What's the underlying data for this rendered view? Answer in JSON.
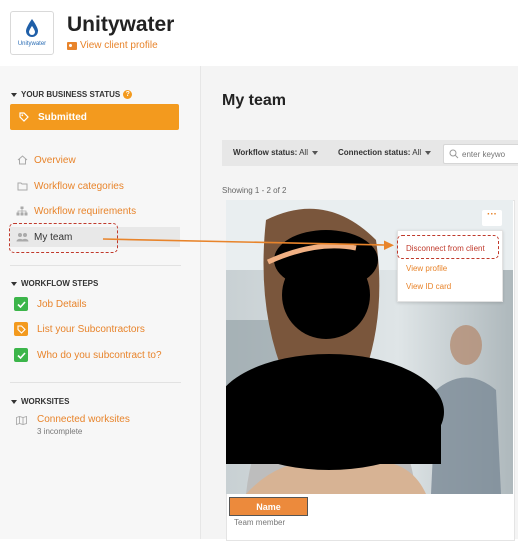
{
  "header": {
    "logo_word": "Unitywater",
    "client_title": "Unitywater",
    "client_link": "View client profile"
  },
  "sidebar": {
    "business_status_heading": "YOUR BUSINESS STATUS",
    "status_button": "Submitted",
    "nav": [
      {
        "label": "Overview",
        "icon": "home-icon"
      },
      {
        "label": "Workflow categories",
        "icon": "folder-icon"
      },
      {
        "label": "Workflow requirements",
        "icon": "hierarchy-icon"
      },
      {
        "label": "My team",
        "icon": "team-icon",
        "active": true
      }
    ],
    "workflow_heading": "WORKFLOW STEPS",
    "steps": [
      {
        "label": "Job Details",
        "state": "complete"
      },
      {
        "label": "List your Subcontractors",
        "state": "in-progress"
      },
      {
        "label": "Who do you subcontract to?",
        "state": "complete"
      }
    ],
    "worksites_heading": "WORKSITES",
    "worksite_link": "Connected worksites",
    "worksite_sub": "3 incomplete"
  },
  "main": {
    "title": "My team",
    "filters": [
      {
        "label": "Workflow status:",
        "value": "All"
      },
      {
        "label": "Connection status:",
        "value": "All"
      }
    ],
    "search_placeholder": "enter keywo",
    "showing": "Showing 1 - 2 of 2",
    "card": {
      "more": "···",
      "menu": [
        "Disconnect from client",
        "View profile",
        "View ID card"
      ],
      "name": "Name",
      "role": "Team member"
    }
  },
  "colors": {
    "accent": "#e8842b",
    "status": "#f39a1e",
    "success": "#3cb54a",
    "highlight": "#c0392b"
  }
}
